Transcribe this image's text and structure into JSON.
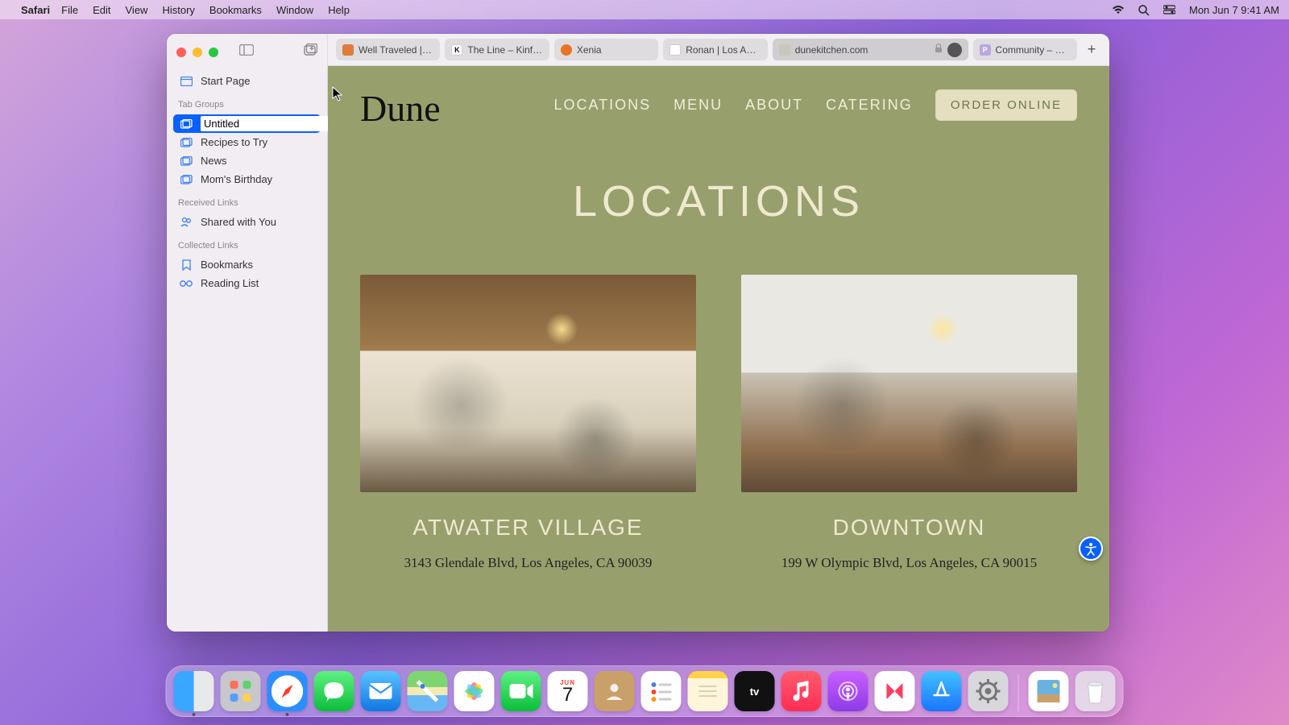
{
  "menubar": {
    "app": "Safari",
    "items": [
      "File",
      "Edit",
      "View",
      "History",
      "Bookmarks",
      "Window",
      "Help"
    ],
    "clock": "Mon Jun 7  9:41 AM"
  },
  "sidebar": {
    "start_page": "Start Page",
    "tab_groups_header": "Tab Groups",
    "editing_group": "Untitled",
    "groups": [
      "Recipes to Try",
      "News",
      "Mom's Birthday"
    ],
    "received_links_header": "Received Links",
    "shared_with_you": "Shared with You",
    "collected_links_header": "Collected Links",
    "bookmarks": "Bookmarks",
    "reading_list": "Reading List"
  },
  "tabs": [
    {
      "title": "Well Traveled |…",
      "favicon_bg": "#e07b3a",
      "favicon_text": ""
    },
    {
      "title": "The Line – Kinfolk",
      "favicon_bg": "#ffffff",
      "favicon_text": "K",
      "favicon_color": "#111"
    },
    {
      "title": "Xenia",
      "favicon_bg": "#e87524",
      "favicon_text": ""
    },
    {
      "title": "Ronan | Los Ang…",
      "favicon_bg": "#ffffff",
      "favicon_text": ""
    },
    {
      "title": "dunekitchen.com",
      "favicon_bg": "#c9c7ba",
      "favicon_text": "",
      "active": true,
      "locked": true,
      "reader": true
    },
    {
      "title": "Community – Pi…",
      "favicon_bg": "#b7a7e3",
      "favicon_text": "P",
      "favicon_color": "#fff"
    }
  ],
  "page": {
    "logo": "Dune",
    "nav": [
      "LOCATIONS",
      "MENU",
      "ABOUT",
      "CATERING"
    ],
    "order_btn": "ORDER ONLINE",
    "title": "LOCATIONS",
    "locations": [
      {
        "name": "ATWATER VILLAGE",
        "address": "3143 Glendale Blvd, Los Angeles, CA 90039"
      },
      {
        "name": "DOWNTOWN",
        "address": "199 W Olympic Blvd, Los Angeles, CA 90015"
      }
    ]
  },
  "dock": {
    "calendar_month": "JUN",
    "calendar_day": "7"
  }
}
